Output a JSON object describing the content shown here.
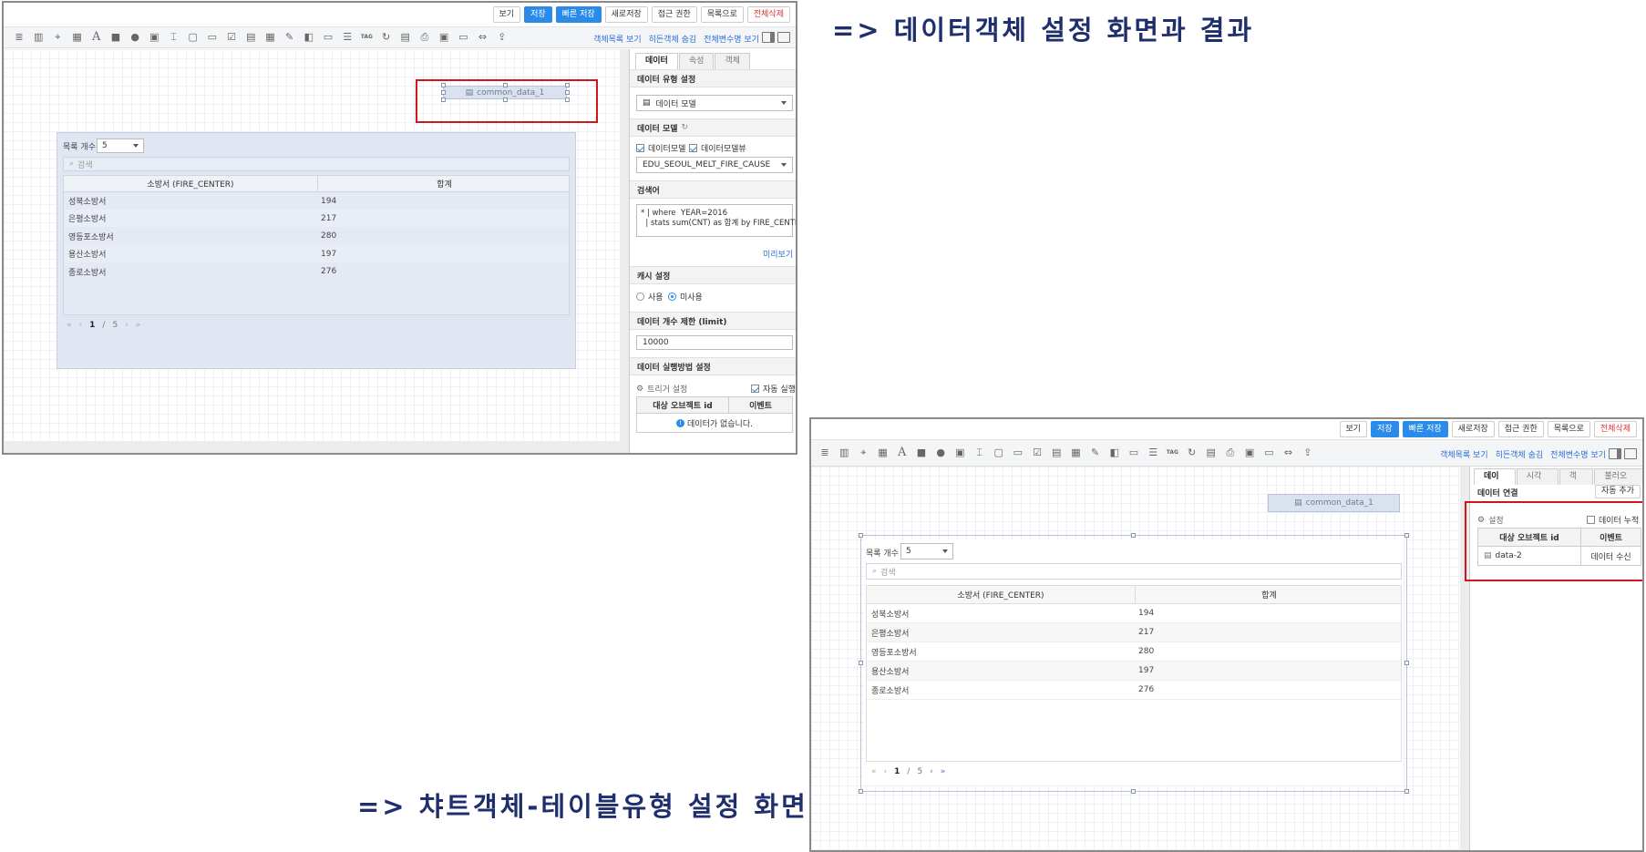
{
  "captions": {
    "top": "=> 데이터객체 설정 화면과 결과",
    "bottom": "=> 챠트객체-테이블유형 설정 화면"
  },
  "topbar": {
    "buttons": [
      "보기",
      "저장",
      "빠른 저장",
      "새로저장",
      "접근 권한",
      "목록으로",
      "전체삭제"
    ]
  },
  "toolbar": {
    "tools_left": [
      "database-icon",
      "bar-chart-icon",
      "map-pin-icon",
      "map-icon",
      "text-icon",
      "rectangle-icon",
      "ellipse-icon",
      "image-icon",
      "input-icon",
      "textbox-icon",
      "dropdown-icon",
      "checkbox-icon",
      "date-icon",
      "calendar-icon",
      "edit-icon",
      "slideshow-icon",
      "tab-icon",
      "list-icon",
      "tag-icon",
      "refresh-icon",
      "form-icon",
      "print-icon",
      "frame-icon",
      "card-icon",
      "slider-icon",
      "upload-icon"
    ],
    "links": [
      "객체목록 보기",
      "히든객체 숨김",
      "전체변수명 보기"
    ]
  },
  "left": {
    "data_chip": "common_data_1",
    "table": {
      "list_count_label": "목록 개수",
      "list_count_value": "5",
      "search_placeholder": "검색",
      "columns": [
        "소방서 (FIRE_CENTER)",
        "합계"
      ],
      "rows": [
        [
          "성북소방서",
          "194"
        ],
        [
          "은평소방서",
          "217"
        ],
        [
          "영등포소방서",
          "280"
        ],
        [
          "용산소방서",
          "197"
        ],
        [
          "종로소방서",
          "276"
        ]
      ],
      "pager": {
        "current": "1",
        "sep": "/",
        "total": "5"
      }
    },
    "panel": {
      "tabs": [
        "데이터",
        "속성",
        "객체"
      ],
      "sec_type": "데이터 유형 설정",
      "type_value": "데이터 모델",
      "sec_model": "데이터 모델",
      "cb_model": "데이터모델",
      "cb_view": "데이터모델뷰",
      "model_value": "EDU_SEOUL_MELT_FIRE_CAUSE",
      "sec_query": "검색어",
      "query_line1": "* | where  YEAR=2016",
      "query_line2": "  | stats sum(CNT) as 합계 by FIRE_CENTER",
      "preview": "미리보기",
      "sec_cache": "캐시 설정",
      "cache_use": "사용",
      "cache_unused": "미사용",
      "sec_limit": "데이터 개수 제한 (limit)",
      "limit_value": "10000",
      "sec_exec": "데이터 실행방법 설정",
      "trigger": "트리거 설정",
      "auto_run": "자동 실행",
      "col_target": "대상 오브젝트 id",
      "col_event": "이벤트",
      "empty_msg": "데이터가 없습니다."
    }
  },
  "right": {
    "data_chip": "common_data_1",
    "table": {
      "list_count_label": "목록 개수",
      "list_count_value": "5",
      "search_placeholder": "검색",
      "columns": [
        "소방서 (FIRE_CENTER)",
        "합계"
      ],
      "rows": [
        [
          "성북소방서",
          "194"
        ],
        [
          "은평소방서",
          "217"
        ],
        [
          "영등포소방서",
          "280"
        ],
        [
          "용산소방서",
          "197"
        ],
        [
          "종로소방서",
          "276"
        ]
      ],
      "pager": {
        "current": "1",
        "sep": "/",
        "total": "5"
      }
    },
    "panel": {
      "tabs": [
        "데이터",
        "시각화",
        "객체",
        "불러오기"
      ],
      "sec_link": "데이터 연결",
      "auto_add": "자동 추가",
      "settings": "설정",
      "accumulate": "데이터 누적",
      "col_target": "대상 오브젝트 id",
      "col_event": "이벤트",
      "row_target": "data-2",
      "row_event": "데이터 수신"
    }
  },
  "colors": {
    "accent": "#2a8be8",
    "highlight": "#d0161c",
    "caption": "#1f2f6e"
  }
}
